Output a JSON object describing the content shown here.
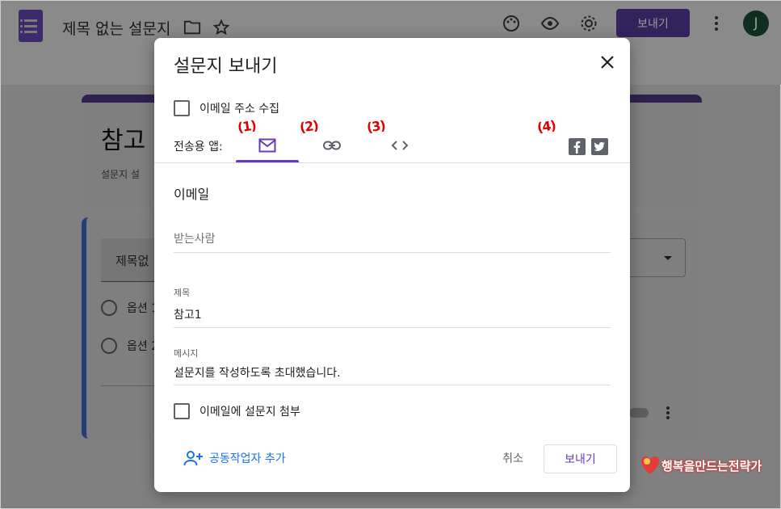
{
  "app": {
    "doc_title": "제목 없는 설문지",
    "send_label": "보내기",
    "avatar_letter": "J",
    "form_title_partial": "참고",
    "form_desc_partial": "설문지 설",
    "question_partial": "제목없",
    "option1_partial": "옵션 1",
    "option2_partial": "옵션 2"
  },
  "dialog": {
    "title": "설문지 보내기",
    "collect_email_label": "이메일 주소 수집",
    "send_via_label": "전송용 앱:",
    "tabs": [
      {
        "name": "email",
        "icon": "mail-icon",
        "active": true
      },
      {
        "name": "link",
        "icon": "link-icon",
        "active": false
      },
      {
        "name": "embed",
        "icon": "embed-code-icon",
        "active": false
      }
    ],
    "social": [
      {
        "name": "facebook",
        "icon": "facebook-icon",
        "glyph": "f"
      },
      {
        "name": "twitter",
        "icon": "twitter-icon",
        "glyph": "t"
      }
    ],
    "annotations": [
      "(1)",
      "(2)",
      "(3)",
      "(4)"
    ],
    "section_heading": "이메일",
    "to_placeholder": "받는사람",
    "subject_label": "제목",
    "subject_value": "참고1",
    "message_label": "메시지",
    "message_value": "설문지를 작성하도록 초대했습니다.",
    "attach_label": "이메일에 설문지 첨부",
    "add_collaborator_label": "공동작업자 추가",
    "cancel_label": "취소",
    "send_label": "보내기"
  },
  "watermark": "행복을만드는전략가",
  "colors": {
    "accent": "#673ab7",
    "link": "#1a73e8",
    "annotation": "#e00000"
  }
}
